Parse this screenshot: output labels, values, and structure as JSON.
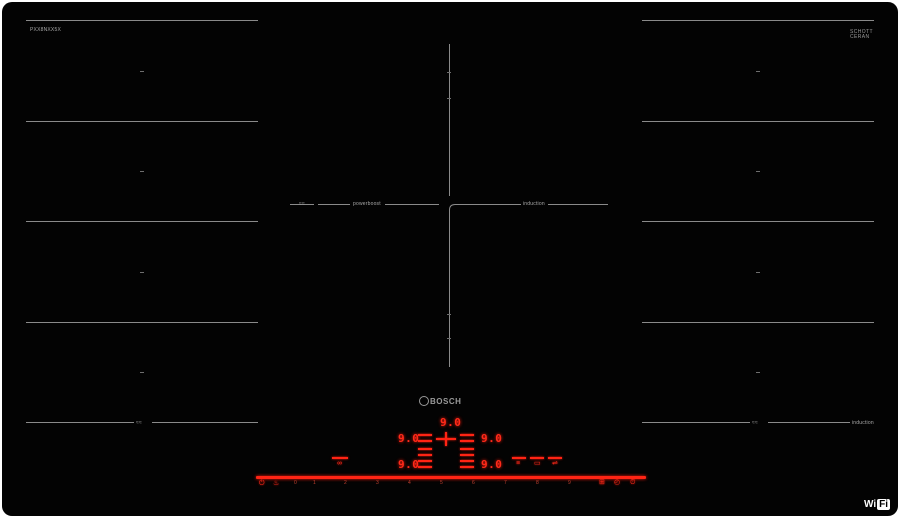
{
  "cooktop": {
    "model_label": "PXX8NXX5X",
    "brand": "BOSCH",
    "glass_brand": {
      "line1": "SCHOTT",
      "line2": "CERAN"
    },
    "zone_labels": {
      "left_upper": "powerboost",
      "right_upper": "induction",
      "right_lower": "induction"
    },
    "flex_marks": {
      "upper": "≈≈",
      "lower_left": "≈≈",
      "lower_right": "≈≈"
    },
    "wifi": {
      "prefix": "Wi",
      "box": "Fi"
    }
  },
  "displays": {
    "top": "9.0",
    "left_upper": "9.0",
    "right_upper": "9.0",
    "left_lower": "9.0",
    "right_lower": "9.0"
  },
  "control_panel": {
    "power_icon": "power-icon",
    "slider_labels": [
      "0",
      "1",
      "2",
      "3",
      "4",
      "5",
      "6",
      "7",
      "8",
      "9"
    ],
    "icons": [
      "lock-icon",
      "flame-icon",
      "timer-icon",
      "menu-icon",
      "clock-icon"
    ]
  },
  "colors": {
    "glass": "#030303",
    "display_red": "#ff2a1a",
    "lines": "#8a8a8a"
  }
}
